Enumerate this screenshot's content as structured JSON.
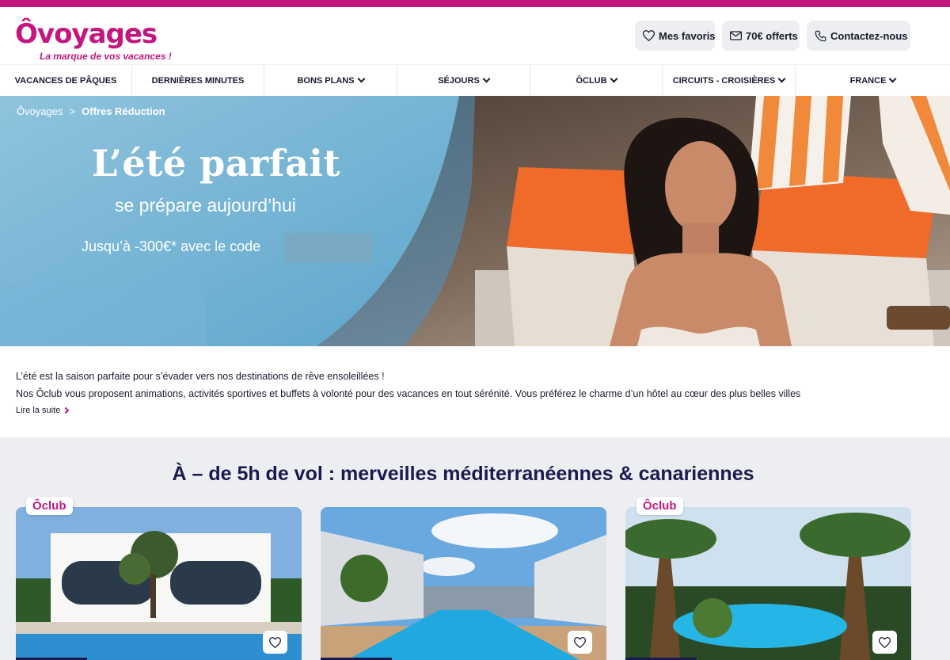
{
  "header": {
    "logo_text": "Ôvoyages",
    "tagline": "La marque de vos vacances !",
    "favorites_label": "Mes favoris",
    "offer_label": "70€ offerts",
    "contact_label": "Contactez-nous"
  },
  "nav": {
    "items": [
      {
        "label": "VACANCES DE PÂQUES",
        "dropdown": false
      },
      {
        "label": "DERNIÈRES MINUTES",
        "dropdown": false
      },
      {
        "label": "BONS PLANS",
        "dropdown": true
      },
      {
        "label": "SÉJOURS",
        "dropdown": true
      },
      {
        "label": "ÔCLUB",
        "dropdown": true
      },
      {
        "label": "CIRCUITS - CROISIÈRES",
        "dropdown": true
      },
      {
        "label": "FRANCE",
        "dropdown": true
      }
    ]
  },
  "breadcrumb": {
    "home": "Ôvoyages",
    "separator": ">",
    "current": "Offres Réduction"
  },
  "hero": {
    "title": "L’été parfait",
    "subtitle": "se prépare aujourd’hui",
    "code_text": "Jusqu’à -300€* avec le code"
  },
  "intro": {
    "line1": "L’été est la saison parfaite pour s’évader vers nos destinations de rêve ensoleillées !",
    "line2": "Nos Ôclub vous proposent animations, activités sportives et buffets à volonté pour des vacances en tout sérénité. Vous préférez le charme d’un hôtel au cœur des plus belles villes",
    "read_more": "Lire la suite"
  },
  "section": {
    "title": "À – de 5h de vol : merveilles méditerranéennes & canariennes",
    "cards": [
      {
        "badge": "Ôclub"
      },
      {
        "badge": ""
      },
      {
        "badge": "Ôclub"
      }
    ]
  },
  "colors": {
    "brand": "#c4177e",
    "navy": "#1a1a4e",
    "section_bg": "#eceef2"
  }
}
